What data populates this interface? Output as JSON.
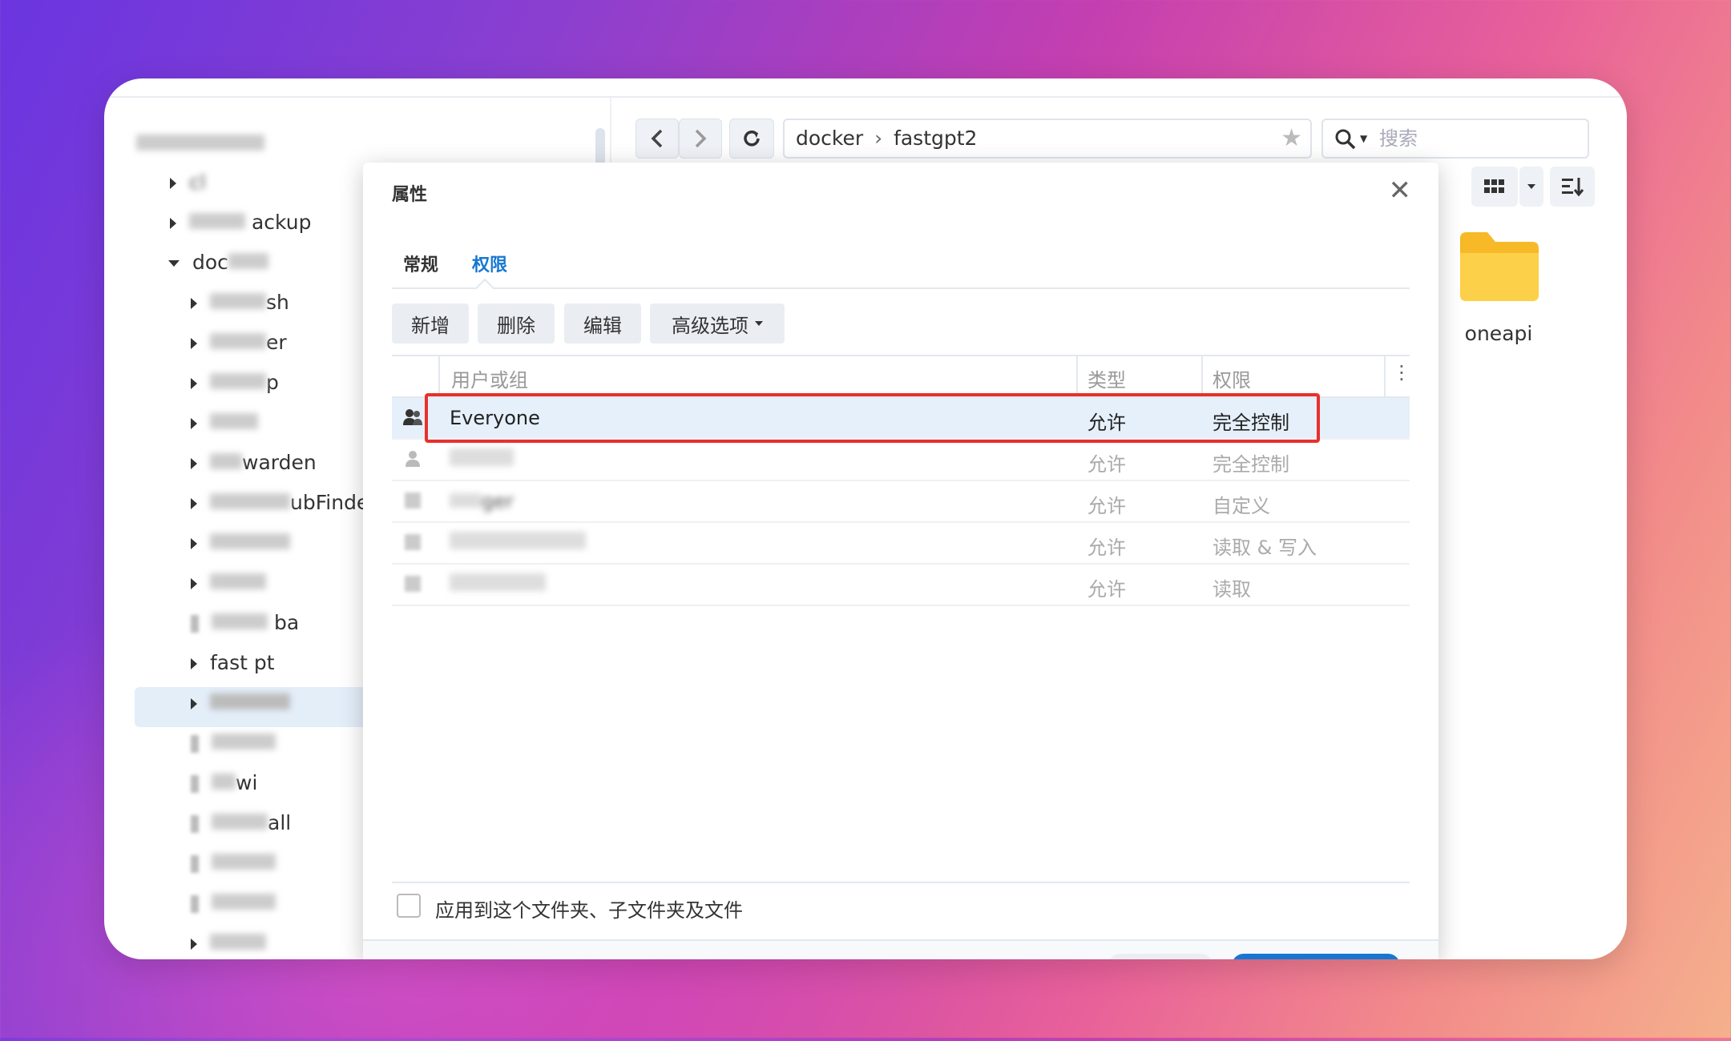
{
  "filestation": {
    "path": {
      "segments": [
        "docker",
        "fastgpt2"
      ],
      "separator": "›"
    },
    "search_placeholder": "搜索",
    "folder": {
      "name": "oneapi"
    },
    "sidebar": {
      "items": [
        {
          "label": "cl",
          "blurred": true
        },
        {
          "label": "ackup",
          "blurred": true
        },
        {
          "label": "doc",
          "blurred": true
        },
        {
          "label": "sh",
          "blurred": true
        },
        {
          "label": "er",
          "blurred": true
        },
        {
          "label": "p",
          "blurred": true
        },
        {
          "label": "",
          "blurred": true
        },
        {
          "label": "warden",
          "blurred": true
        },
        {
          "label": "ubFinde",
          "blurred": true
        },
        {
          "label": "u",
          "blurred": true
        },
        {
          "label": "m",
          "blurred": true
        },
        {
          "label": "ba",
          "blurred": true
        },
        {
          "label": "fast pt",
          "blurred": false
        },
        {
          "label": "",
          "blurred": true
        },
        {
          "label": "",
          "blurred": true
        },
        {
          "label": "wi",
          "blurred": true
        },
        {
          "label": "all",
          "blurred": true
        },
        {
          "label": "",
          "blurred": true
        },
        {
          "label": "",
          "blurred": true
        },
        {
          "label": "",
          "blurred": true
        }
      ]
    }
  },
  "dialog": {
    "title": "属性",
    "tabs": [
      "常规",
      "权限"
    ],
    "active_tab": "权限",
    "buttons": {
      "add": "新增",
      "delete": "删除",
      "edit": "编辑",
      "advanced": "高级选项"
    },
    "table": {
      "headers": {
        "user": "用户或组",
        "type": "类型",
        "perm": "权限"
      },
      "rows": [
        {
          "name": "Everyone",
          "type": "允许",
          "perm": "完全控制",
          "selected": true
        },
        {
          "name": "",
          "type": "允许",
          "perm": "完全控制",
          "blurred": true
        },
        {
          "name": "ger",
          "type": "允许",
          "perm": "自定义",
          "blurred": true
        },
        {
          "name": "",
          "type": "允许",
          "perm": "读取 & 写入",
          "blurred": true
        },
        {
          "name": "",
          "type": "允许",
          "perm": "读取",
          "blurred": true
        }
      ]
    },
    "apply_label": "应用到这个文件夹、子文件夹及文件"
  },
  "colors": {
    "accent": "#1677d2",
    "highlight": "#e8312b",
    "selected_row": "#e6f0fb"
  }
}
